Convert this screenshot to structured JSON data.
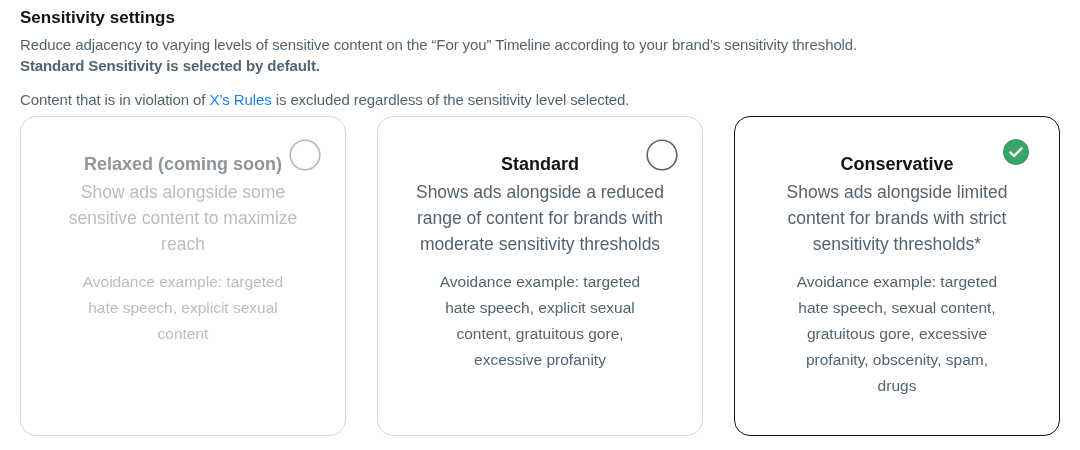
{
  "heading": "Sensitivity settings",
  "intro": "Reduce adjacency to varying levels of sensitive content on the “For you” Timeline according to your brand’s sensitivity threshold.",
  "default_note": "Standard Sensitivity is selected by default.",
  "rules_note": {
    "before": "Content that is in violation of ",
    "link": "X’s Rules",
    "after": " is excluded regardless of the sensitivity level selected."
  },
  "options": [
    {
      "title": "Relaxed (coming soon)",
      "summary": "Show ads alongside some sensitive content to maximize reach",
      "example": "Avoidance example: targeted hate speech, explicit sexual content",
      "disabled": true,
      "selected": false
    },
    {
      "title": "Standard",
      "summary": "Shows ads alongside a reduced range of content for brands with moderate sensitivity thresholds",
      "example": "Avoidance example: targeted hate speech, explicit sexual content, gratuitous gore, excessive profanity",
      "disabled": false,
      "selected": false
    },
    {
      "title": "Conservative",
      "summary": "Shows ads alongside limited content for brands with strict sensitivity thresholds*",
      "example": "Avoidance example: targeted hate speech, sexual content, gratuitous gore, excessive profanity, obscenity, spam, drugs",
      "disabled": false,
      "selected": true
    }
  ]
}
